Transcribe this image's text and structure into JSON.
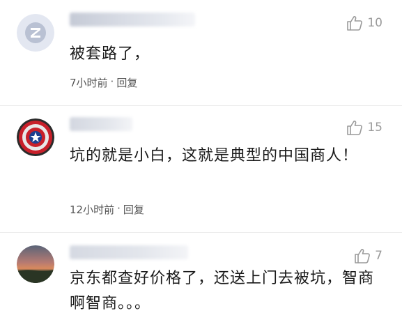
{
  "comments": [
    {
      "text": "被套路了，",
      "time": "7小时前",
      "separator": "·",
      "reply_label": "回复",
      "likes": "10",
      "avatar_icon": "default-avatar-icon"
    },
    {
      "text": "坑的就是小白，这就是典型的中国商人！",
      "time": "12小时前",
      "separator": "·",
      "reply_label": "回复",
      "likes": "15",
      "avatar_icon": "captain-america-shield-avatar"
    },
    {
      "text": "京东都查好价格了，还送上门去被坑，智商啊智商。。。",
      "likes": "7",
      "avatar_icon": "sunset-field-avatar"
    }
  ],
  "colors": {
    "text": "#1a1a1a",
    "meta": "#555555",
    "like": "#9a9a9a",
    "divider": "#ececec"
  }
}
